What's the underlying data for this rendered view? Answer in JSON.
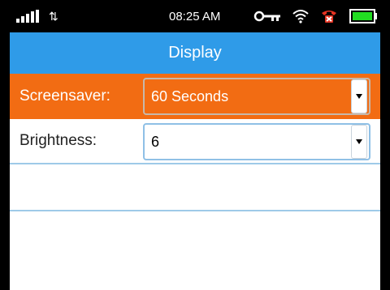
{
  "status_bar": {
    "time": "08:25 AM",
    "signal_icon": "signal-bars-icon",
    "data_icon": "data-transfer-arrows-icon",
    "key_icon": "key-icon",
    "wifi_icon": "wifi-icon",
    "phone_icon": "missed-call-icon",
    "battery_icon": "battery-icon"
  },
  "header": {
    "title": "Display"
  },
  "settings": {
    "screensaver": {
      "label": "Screensaver:",
      "value": "60 Seconds"
    },
    "brightness": {
      "label": "Brightness:",
      "value": "6"
    }
  },
  "colors": {
    "header": "#2f9be8",
    "selected_row": "#f26c13",
    "divider": "#9ecae8",
    "battery_fill": "#22dd22",
    "phone_icon": "#e53322"
  }
}
